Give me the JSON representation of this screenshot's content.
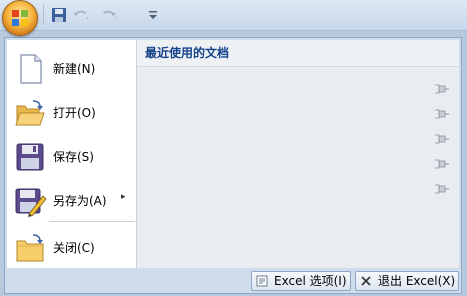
{
  "menu": {
    "items": [
      {
        "label": "新建(N)",
        "icon": "new-document-icon"
      },
      {
        "label": "打开(O)",
        "icon": "open-folder-icon"
      },
      {
        "label": "保存(S)",
        "icon": "save-disk-icon"
      },
      {
        "label": "另存为(A)",
        "icon": "save-as-icon",
        "submenu_arrow": "▸"
      },
      {
        "label": "关闭(C)",
        "icon": "close-folder-icon"
      }
    ]
  },
  "recent": {
    "title": "最近使用的文档"
  },
  "footer": {
    "options_label": "Excel 选项(I)",
    "exit_label": "退出 Excel(X)"
  },
  "colors": {
    "accent": "#15428b",
    "frame": "#cfdcec",
    "border": "#8ea7c8"
  }
}
